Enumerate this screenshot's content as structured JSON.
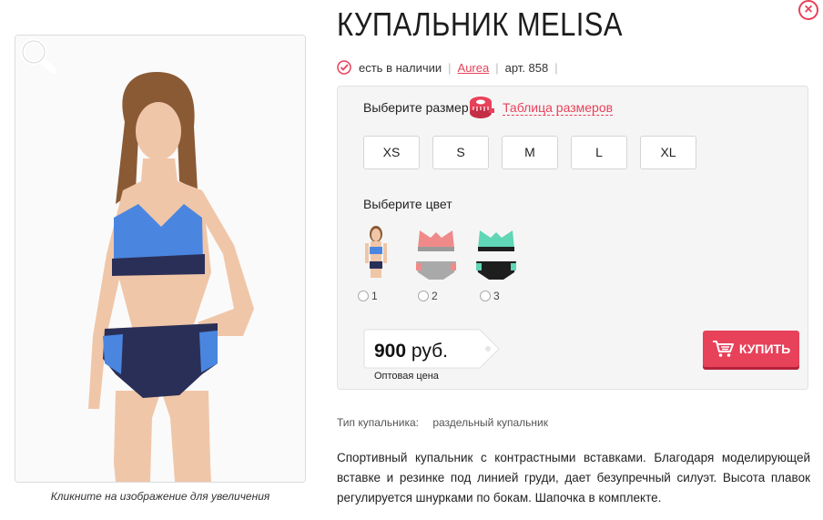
{
  "product": {
    "title": "КУПАЛЬНИК MELISA",
    "availability": "есть в наличии",
    "brand": "Aurea",
    "article": "арт. 858"
  },
  "photo": {
    "caption": "Кликните на изображение для увеличения"
  },
  "size": {
    "label": "Выберите размер",
    "table_link": "Таблица размеров",
    "options": [
      "XS",
      "S",
      "M",
      "L",
      "XL"
    ]
  },
  "color": {
    "label": "Выберите цвет",
    "options": [
      {
        "label": "1",
        "top": "#4a86e0",
        "bottom": "#2a2f57"
      },
      {
        "label": "2",
        "top": "#f08a8a",
        "bottom": "#a9a9a9"
      },
      {
        "label": "3",
        "top": "#5fd6b5",
        "bottom": "#1e1e1e"
      }
    ]
  },
  "price": {
    "amount": "900",
    "currency": "руб.",
    "note": "Оптовая цена"
  },
  "buy_label": "КУПИТЬ",
  "specs": {
    "type_label": "Тип купальника:",
    "type_value": "раздельный купальник"
  },
  "description": "Спортивный купальник с контрастными вставками. Благодаря моделирующей вставке и резинке под линией груди, дает безупречный силуэт. Высота плавок регулируется шнурками по бокам. Шапочка в комплекте.",
  "colors": {
    "accent": "#e8415a",
    "panel_bg": "#f5f5f5"
  },
  "icons": {
    "close": "close-icon",
    "availability": "check-circle-icon",
    "size_table": "measuring-tape-icon",
    "zoom": "magnifier-icon",
    "cart": "cart-icon"
  }
}
